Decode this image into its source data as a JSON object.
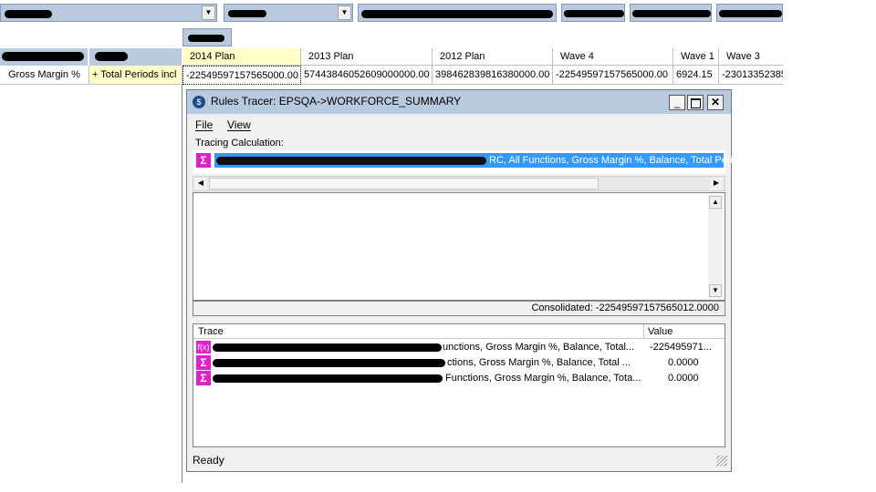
{
  "grid": {
    "columns": [
      "2014 Plan",
      "2013 Plan",
      "2012 Plan",
      "Wave 4",
      "Wave 1",
      "Wave 3"
    ],
    "row_label": "Gross Margin %",
    "row_total": "+ Total Periods incl",
    "values": [
      "-22549597157565000.00",
      "57443846052609000000.00",
      "398462839816380000.00",
      "-22549597157565000.00",
      "6924.15",
      "-23013352385"
    ]
  },
  "tracer": {
    "title": "Rules Tracer: EPSQA->WORKFORCE_SUMMARY",
    "menu": [
      "File",
      "View"
    ],
    "tracing_label": "Tracing Calculation:",
    "selected_suffix": "RC, All Functions, Gross Margin %, Balance, Total Peri",
    "consolidated": "Consolidated: -22549597157565012.0000",
    "trace_header": "Trace",
    "value_header": "Value",
    "rows": [
      {
        "icon": "f(x)",
        "text": "unctions, Gross Margin %, Balance, Total...",
        "value": "-225495971..."
      },
      {
        "icon": "Σ",
        "text": "ctions, Gross Margin %, Balance, Total ...",
        "value": "0.0000"
      },
      {
        "icon": "Σ",
        "text": "Functions, Gross Margin %, Balance, Tota...",
        "value": "0.0000"
      }
    ],
    "status": "Ready"
  },
  "colors": {
    "accent": "#b9c9de",
    "selected_row": "#3399ff",
    "icon_magenta": "#e020c8",
    "highlight_header": "#ffffc8"
  },
  "icons": {
    "dropdown": "chevron-down-icon",
    "minimize": "minimize-icon",
    "maximize": "maximize-icon",
    "close": "close-icon",
    "sigma": "sigma-icon",
    "function": "function-icon"
  }
}
